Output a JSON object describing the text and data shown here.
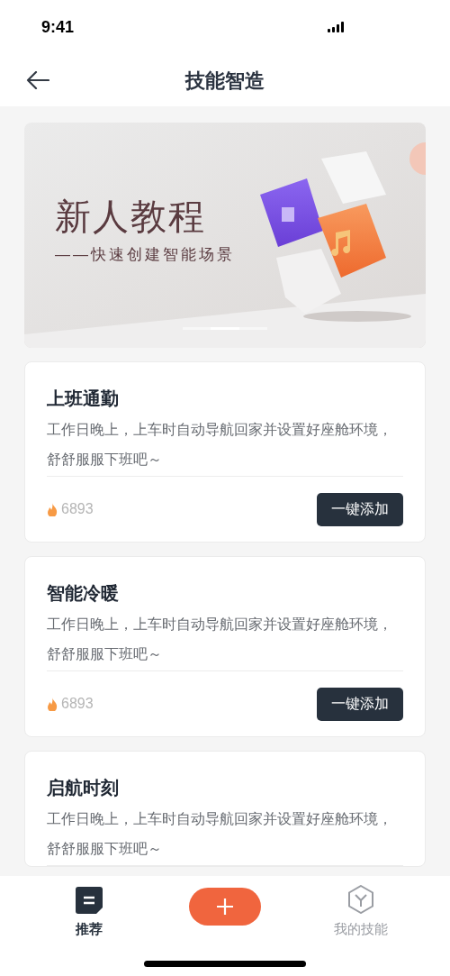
{
  "status_bar": {
    "time": "9:41"
  },
  "header": {
    "title": "技能智造"
  },
  "banner": {
    "title": "新人教程",
    "subtitle": "——快速创建智能场景",
    "pages": [
      {
        "selected": false
      },
      {
        "selected": true
      },
      {
        "selected": false
      }
    ]
  },
  "cards": [
    {
      "title": "上班通勤",
      "description": "工作日晚上，上车时自动导航回家并设置好座舱环境，舒舒服服下班吧～",
      "count": "6893",
      "button": "一键添加"
    },
    {
      "title": "智能冷暖",
      "description": "工作日晚上，上车时自动导航回家并设置好座舱环境，舒舒服服下班吧～",
      "count": "6893",
      "button": "一键添加"
    },
    {
      "title": "启航时刻",
      "description": "工作日晚上，上车时自动导航回家并设置好座舱环境，舒舒服服下班吧～"
    }
  ],
  "tab_bar": {
    "items": [
      {
        "kind": "recommend",
        "label": "推荐",
        "selected": true
      },
      {
        "kind": "add"
      },
      {
        "kind": "skills",
        "label": "我的技能",
        "selected": false
      }
    ]
  }
}
